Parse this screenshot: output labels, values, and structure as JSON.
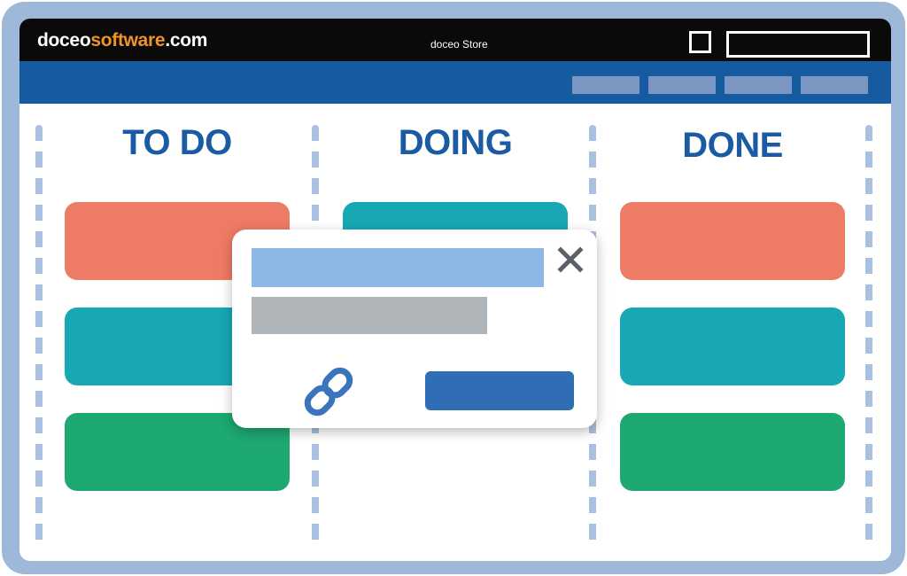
{
  "header": {
    "brand_prefix": "doceo",
    "brand_accent": "software",
    "brand_suffix": ".com",
    "store_title": "doceo Store"
  },
  "board": {
    "columns": [
      {
        "title": "TO DO",
        "cards": [
          "coral",
          "teal",
          "green"
        ]
      },
      {
        "title": "DOING",
        "cards": [
          "teal"
        ]
      },
      {
        "title": "DONE",
        "cards": [
          "coral",
          "teal",
          "green"
        ]
      }
    ]
  },
  "dialog": {
    "icons": [
      "close-icon",
      "link-icon"
    ]
  },
  "colors": {
    "frame": "#9db8d8",
    "topbar": "#0a0a0a",
    "navbar": "#165aa0",
    "nav_button": "#7a96c2",
    "brand_accent": "#f0932b",
    "column_title": "#1a5ba3",
    "coral": "#ee7b66",
    "teal": "#17a8b4",
    "green": "#1ea872",
    "dialog_bar_primary": "#8cb6e3",
    "dialog_bar_secondary": "#b0b5ba",
    "dialog_button": "#2f6db4",
    "icon": "#3a74bd",
    "close_icon": "#5a6168"
  }
}
